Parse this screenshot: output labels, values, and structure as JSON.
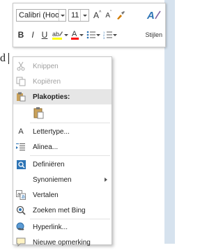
{
  "background": {
    "doc_text": "d"
  },
  "mini_toolbar": {
    "font_name": "Calibri (Hoofdt",
    "font_size": "11",
    "grow_glyph": "A",
    "shrink_glyph": "A",
    "bold": "B",
    "italic": "I",
    "underline": "U",
    "styles_label": "Stijlen",
    "colors": {
      "highlight": "#ffff00",
      "font_color": "#ff0000",
      "styles_a": "#2e75b6"
    }
  },
  "context_menu": {
    "items": [
      {
        "label": "Knippen",
        "icon": "scissors-icon",
        "disabled": true
      },
      {
        "label": "Kopiëren",
        "icon": "copy-icon",
        "disabled": true
      },
      {
        "label": "Plakopties:",
        "icon": "paste-icon"
      },
      {
        "label": "",
        "icon": "paste-keep-format-icon"
      },
      {
        "label": "Lettertype...",
        "icon": "font-icon"
      },
      {
        "label": "Alinea...",
        "icon": "paragraph-icon"
      },
      {
        "label": "Definiëren",
        "icon": "define-icon"
      },
      {
        "label": "Synoniemen",
        "icon": "synonyms-icon"
      },
      {
        "label": "Vertalen",
        "icon": "translate-icon"
      },
      {
        "label": "Zoeken met Bing",
        "icon": "bing-search-icon"
      },
      {
        "label": "Hyperlink...",
        "icon": "hyperlink-icon"
      },
      {
        "label": "Nieuwe opmerking",
        "icon": "new-comment-icon"
      }
    ]
  }
}
